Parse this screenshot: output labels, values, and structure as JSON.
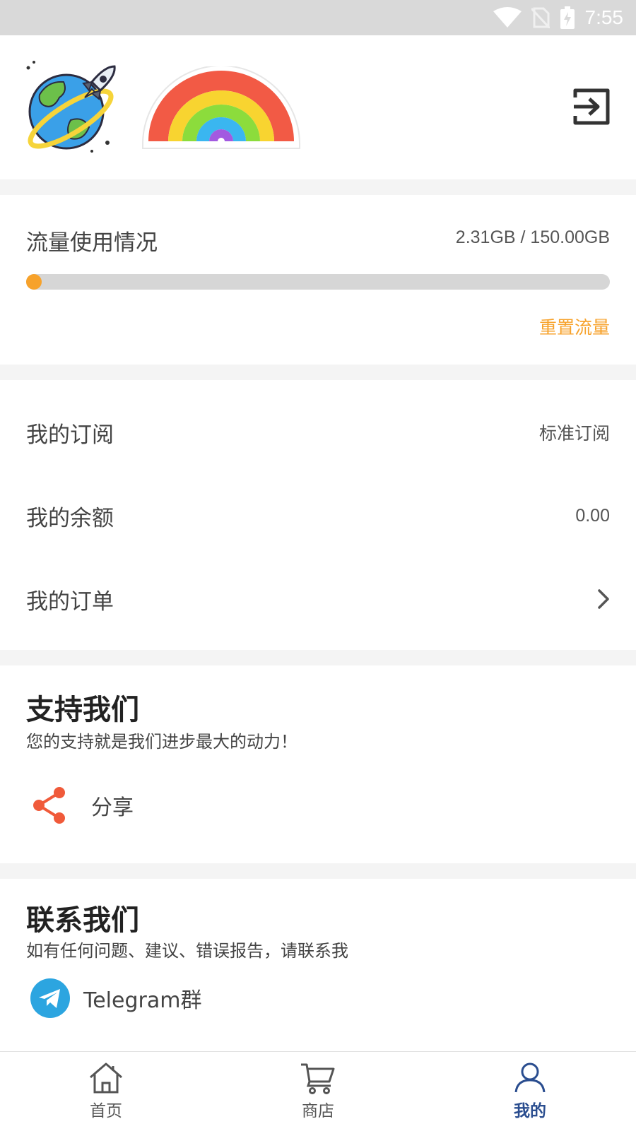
{
  "status_bar": {
    "time": "7:55"
  },
  "traffic": {
    "title": "流量使用情况",
    "amount": "2.31GB / 150.00GB",
    "used_gb": 2.31,
    "total_gb": 150.0,
    "reset_label": "重置流量"
  },
  "account": {
    "subscription_label": "我的订阅",
    "subscription_value": "标准订阅",
    "balance_label": "我的余额",
    "balance_value": "0.00",
    "orders_label": "我的订单"
  },
  "support": {
    "title": "支持我们",
    "subtitle": "您的支持就是我们进步最大的动力！",
    "share_label": "分享"
  },
  "contact": {
    "title": "联系我们",
    "subtitle": "如有任何问题、建议、错误报告，请联系我",
    "telegram_label": "Telegram群"
  },
  "tabbar": {
    "items": [
      {
        "label": "首页",
        "icon": "home-icon"
      },
      {
        "label": "商店",
        "icon": "cart-icon"
      },
      {
        "label": "我的",
        "icon": "person-icon",
        "active": true
      }
    ]
  },
  "colors": {
    "accent": "#f7a22b",
    "active_tab": "#2a4d8f",
    "share": "#f05a3a",
    "telegram": "#2ca5e0"
  }
}
